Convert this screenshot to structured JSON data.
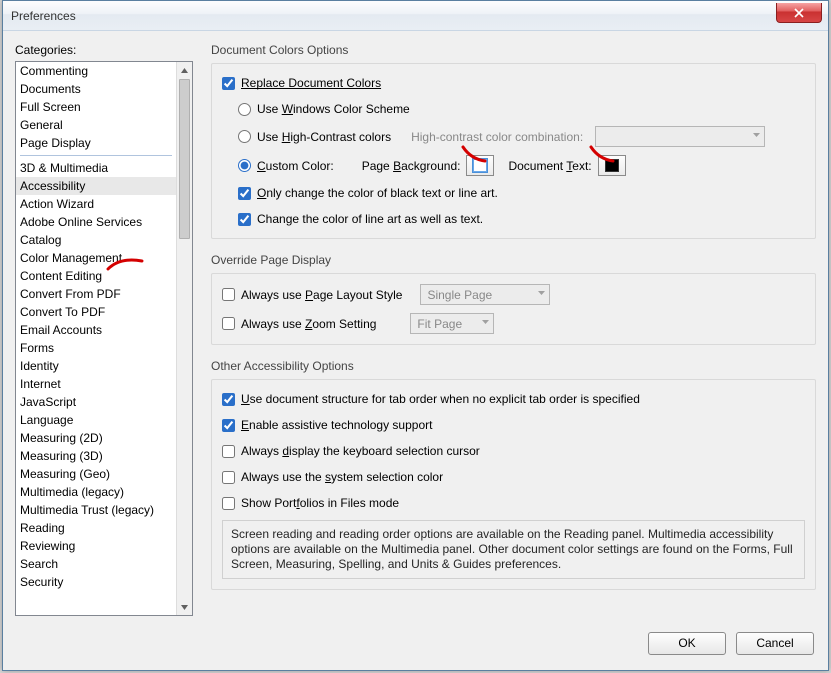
{
  "window": {
    "title": "Preferences"
  },
  "categories": {
    "label": "Categories:",
    "groups": [
      [
        "Commenting",
        "Documents",
        "Full Screen",
        "General",
        "Page Display"
      ],
      [
        "3D & Multimedia",
        "Accessibility",
        "Action Wizard",
        "Adobe Online Services",
        "Catalog",
        "Color Management",
        "Content Editing",
        "Convert From PDF",
        "Convert To PDF",
        "Email Accounts",
        "Forms",
        "Identity",
        "Internet",
        "JavaScript",
        "Language",
        "Measuring (2D)",
        "Measuring (3D)",
        "Measuring (Geo)",
        "Multimedia (legacy)",
        "Multimedia Trust (legacy)",
        "Reading",
        "Reviewing",
        "Search",
        "Security"
      ]
    ],
    "selected": "Accessibility"
  },
  "doc_colors": {
    "title": "Document Colors Options",
    "replace": "Replace Document Colors",
    "use_windows_pre": "Use ",
    "use_windows_u": "W",
    "use_windows_post": "indows Color Scheme",
    "use_hc_pre": "Use ",
    "use_hc_u": "H",
    "use_hc_post": "igh-Contrast colors",
    "hc_label": "High-contrast color combination:",
    "custom_u": "C",
    "custom_post": "ustom Color:",
    "page_bg_pre": "Page ",
    "page_bg_u": "B",
    "page_bg_post": "ackground:",
    "doc_txt_pre": "Document ",
    "doc_txt_u": "T",
    "doc_txt_post": "ext:",
    "only_black_u": "O",
    "only_black_post": "nly change the color of black text or line art.",
    "change_lineart": "Change the color of line art as well as text."
  },
  "override": {
    "title": "Override Page Display",
    "layout_pre": "Always use ",
    "layout_u": "P",
    "layout_post": "age Layout Style",
    "layout_value": "Single Page",
    "zoom_pre": "Always use ",
    "zoom_u": "Z",
    "zoom_post": "oom Setting",
    "zoom_value": "Fit Page"
  },
  "other": {
    "title": "Other Accessibility Options",
    "tab_u": "U",
    "tab_post": "se document structure for tab order when no explicit tab order is specified",
    "assist_u": "E",
    "assist_post": "nable assistive technology support",
    "kb_pre": "Always ",
    "kb_u": "d",
    "kb_post": "isplay the keyboard selection cursor",
    "sys_pre": "Always use the ",
    "sys_u": "s",
    "sys_post": "ystem selection color",
    "port_pre": "Show Port",
    "port_u": "f",
    "port_post": "olios in Files mode",
    "note": "Screen reading and reading order options are available on the Reading panel. Multimedia accessibility options are available on the Multimedia panel. Other document color settings are found on the Forms, Full Screen, Measuring, Spelling, and Units & Guides preferences."
  },
  "buttons": {
    "ok": "OK",
    "cancel": "Cancel"
  }
}
